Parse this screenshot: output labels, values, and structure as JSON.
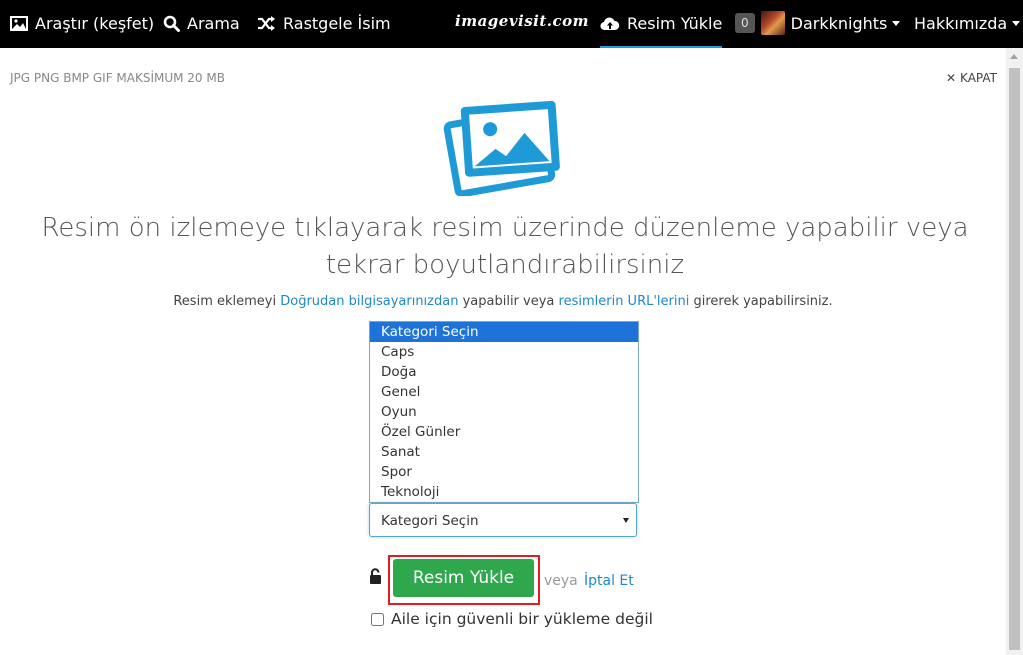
{
  "nav": {
    "explore": "Araştır (keşfet)",
    "search": "Arama",
    "random": "Rastgele İsim",
    "logo": "imagevisit.com",
    "upload": "Resim Yükle",
    "notif_count": "0",
    "username": "Darkknights",
    "about": "Hakkımızda"
  },
  "formats": "JPG PNG BMP GIF  MAKSİMUM 20 MB",
  "close_label": "KAPAT",
  "headline": "Resim ön izlemeye tıklayarak resim üzerinde düzenleme yapabilir veya tekrar boyutlandırabilirsiniz",
  "subline": {
    "prefix": "Resim eklemeyi ",
    "link1": "Doğrudan bilgisayarınızdan",
    "middle": " yapabilir veya ",
    "link2": "resimlerin URL'lerini",
    "suffix": " girerek yapabilirsiniz."
  },
  "category": {
    "options": [
      "Kategori Seçin",
      "Caps",
      "Doğa",
      "Genel",
      "Oyun",
      "Özel Günler",
      "Sanat",
      "Spor",
      "Teknoloji"
    ],
    "selected": "Kategori Seçin"
  },
  "actions": {
    "upload_button": "Resim Yükle",
    "or": "veya",
    "cancel": "İptal Et",
    "nsfw_label": "Aile için güvenli bir yükleme değil"
  },
  "colors": {
    "navbar": "#000000",
    "accent": "#1e9ad6",
    "upload_button": "#2ea74d",
    "highlight": "#e31b23",
    "link": "#1e88c9"
  }
}
